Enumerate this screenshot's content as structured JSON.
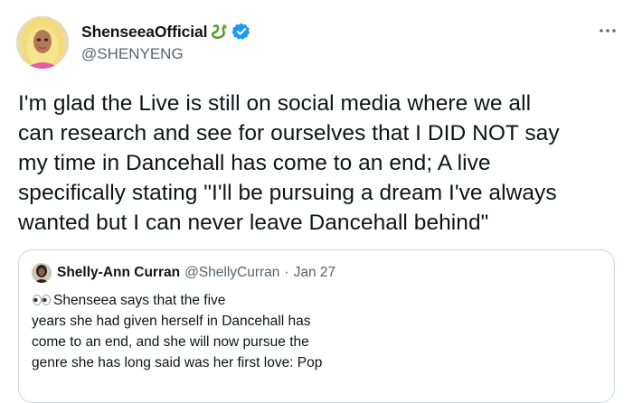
{
  "tweet": {
    "author": {
      "display_name": "ShenseeaOfficial",
      "handle": "@SHENYENG",
      "emoji_icon": "snake-icon",
      "verified_icon": "verified-badge-icon"
    },
    "more_icon": "more-options-icon",
    "text_lines": [
      "I'm glad the Live is still on social media where we all",
      "can research and see for ourselves that I DID NOT say",
      "my time in Dancehall has come to an end; A live",
      "specifically stating \"I'll be pursuing a dream I've always",
      "wanted but I can never leave Dancehall behind\""
    ]
  },
  "quote": {
    "display_name": "Shelly-Ann Curran",
    "handle": "@ShellyCurran",
    "separator": "·",
    "date": "Jan 27",
    "emoji_icon": "eyes-icon",
    "text_lines": [
      "Shenseea says that the five",
      "years she had given herself in Dancehall has",
      "come to an end, and she will now pursue the",
      "genre she has long said was her first love: Pop"
    ]
  },
  "colors": {
    "text_primary": "#0f1419",
    "text_secondary": "#536471",
    "verified_blue": "#1d9bf0",
    "border": "#cfd9de",
    "snake_green": "#5a9e3a"
  }
}
